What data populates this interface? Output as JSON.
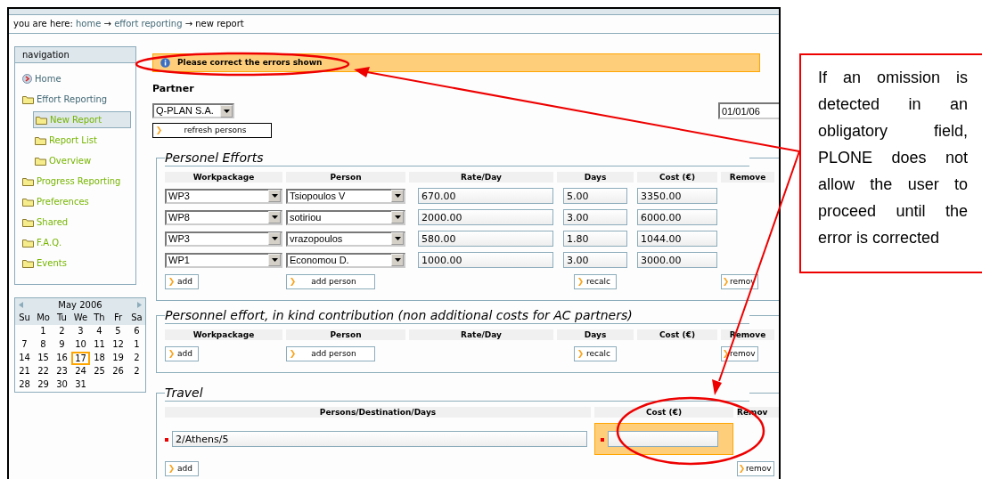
{
  "breadcrumb": {
    "label": "you are here:",
    "separator": "→",
    "items": [
      {
        "label": "home",
        "link": true
      },
      {
        "label": "effort reporting",
        "link": true
      },
      {
        "label": "new report",
        "link": false
      }
    ]
  },
  "navigation": {
    "title": "navigation",
    "items": [
      {
        "label": "Home",
        "kind": "home",
        "selected": false
      },
      {
        "label": "Effort Reporting",
        "kind": "folder",
        "selected": false,
        "children": [
          {
            "label": "New Report",
            "kind": "folder",
            "selected": true
          },
          {
            "label": "Report List",
            "kind": "folder",
            "selected": false
          },
          {
            "label": "Overview",
            "kind": "folder",
            "selected": false
          }
        ]
      },
      {
        "label": "Progress Reporting",
        "kind": "folder",
        "selected": false
      },
      {
        "label": "Preferences",
        "kind": "folder",
        "selected": false
      },
      {
        "label": "Shared",
        "kind": "folder",
        "selected": false
      },
      {
        "label": "F.A.Q.",
        "kind": "folder",
        "selected": false
      },
      {
        "label": "Events",
        "kind": "folder",
        "selected": false
      }
    ]
  },
  "calendar": {
    "title": "May 2006",
    "weekdays": [
      "Su",
      "Mo",
      "Tu",
      "We",
      "Th",
      "Fr",
      "Sa"
    ],
    "weeks": [
      [
        {
          "label": "1",
          "selected": false
        },
        {
          "label": "2",
          "selected": false
        },
        {
          "label": "3",
          "selected": false
        },
        {
          "label": "4",
          "selected": false
        },
        {
          "label": "5",
          "selected": false
        },
        {
          "label": "6",
          "selected": false
        }
      ],
      [
        {
          "label": "7",
          "selected": false
        },
        {
          "label": "8",
          "selected": false
        },
        {
          "label": "9",
          "selected": false
        },
        {
          "label": "10",
          "selected": false
        },
        {
          "label": "11",
          "selected": false
        },
        {
          "label": "12",
          "selected": false
        },
        {
          "label": "1",
          "selected": false
        }
      ],
      [
        {
          "label": "14",
          "selected": false
        },
        {
          "label": "15",
          "selected": false
        },
        {
          "label": "16",
          "selected": false
        },
        {
          "label": "17",
          "selected": true
        },
        {
          "label": "18",
          "selected": false
        },
        {
          "label": "19",
          "selected": false
        },
        {
          "label": "2",
          "selected": false
        }
      ],
      [
        {
          "label": "21",
          "selected": false
        },
        {
          "label": "22",
          "selected": false
        },
        {
          "label": "23",
          "selected": false
        },
        {
          "label": "24",
          "selected": false
        },
        {
          "label": "25",
          "selected": false
        },
        {
          "label": "26",
          "selected": false
        },
        {
          "label": "2",
          "selected": false
        }
      ],
      [
        {
          "label": "28",
          "selected": false
        },
        {
          "label": "29",
          "selected": false
        },
        {
          "label": "30",
          "selected": false
        },
        {
          "label": "31",
          "selected": false
        }
      ]
    ]
  },
  "message": "Please correct the errors shown",
  "partner": {
    "label": "Partner",
    "value": "Q-PLAN S.A.",
    "button": "refresh persons",
    "period": "01/01/06"
  },
  "sections": [
    {
      "title": "Personel Efforts",
      "columns": [
        "Workpackage",
        "Person",
        "Rate/Day",
        "Days",
        "Cost (€)",
        "Remove"
      ],
      "rows": [
        {
          "workpackage": "WP3",
          "person": "Tsiopoulos V",
          "rate": "670.00",
          "days": "5.00",
          "cost": "3350.00"
        },
        {
          "workpackage": "WP8",
          "person": "sotiriou",
          "rate": "2000.00",
          "days": "3.00",
          "cost": "6000.00"
        },
        {
          "workpackage": "WP3",
          "person": "vrazopoulos",
          "rate": "580.00",
          "days": "1.80",
          "cost": "1044.00"
        },
        {
          "workpackage": "WP1",
          "person": "Economou D.",
          "rate": "1000.00",
          "days": "3.00",
          "cost": "3000.00"
        }
      ],
      "buttons": [
        "add",
        "add person",
        "recalc",
        "remov"
      ]
    },
    {
      "title": "Personnel effort, in kind contribution (non additional costs for AC partners)",
      "columns": [
        "Workpackage",
        "Person",
        "Rate/Day",
        "Days",
        "Cost (€)",
        "Remove"
      ],
      "buttons": [
        "add",
        "add person",
        "recalc",
        "remov"
      ]
    }
  ],
  "travel": {
    "title": "Travel",
    "columns": [
      "Persons/Destination/Days",
      "Cost (€)",
      "Remov"
    ],
    "rows": [
      {
        "destination": "2/Athens/5",
        "required": true,
        "cost_error": true
      }
    ],
    "buttons": [
      "add",
      "remov"
    ]
  },
  "callout": "If an omission is detected in an obligatory field, PLONE does not allow the user to proceed until the error is corrected"
}
